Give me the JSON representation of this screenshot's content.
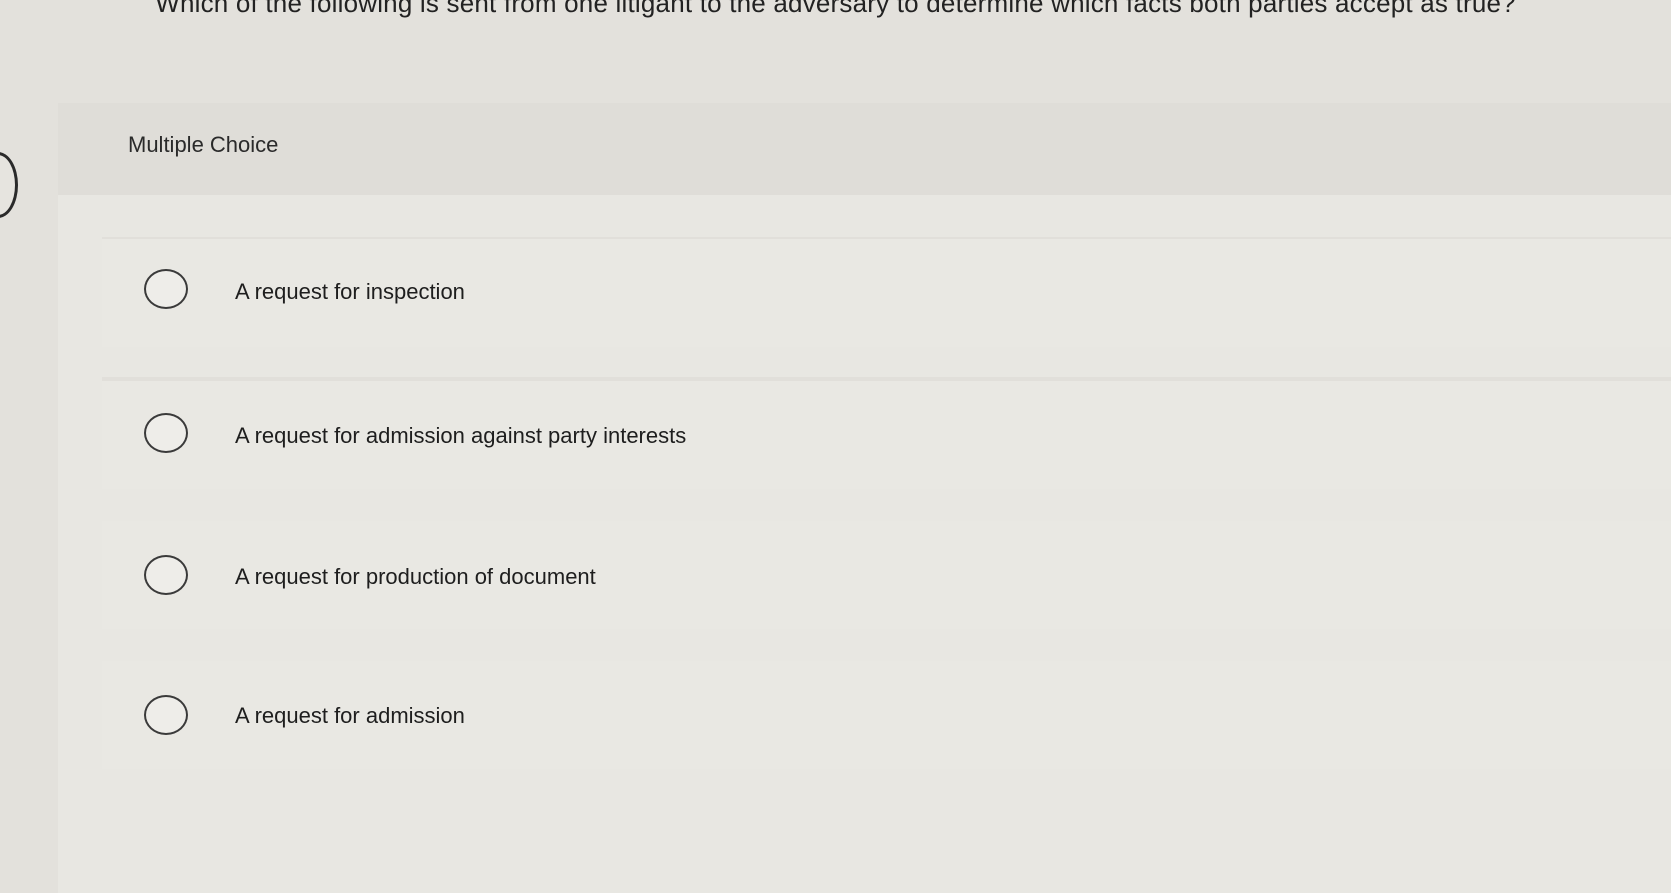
{
  "question": {
    "text": "Which of the following is sent from one litigant to the adversary to determine which facts both parties accept as true?"
  },
  "card": {
    "title": "Multiple Choice"
  },
  "options": [
    {
      "label": "A request for inspection"
    },
    {
      "label": "A request for admission against party interests"
    },
    {
      "label": "A request for production of document"
    },
    {
      "label": "A request for admission"
    }
  ]
}
